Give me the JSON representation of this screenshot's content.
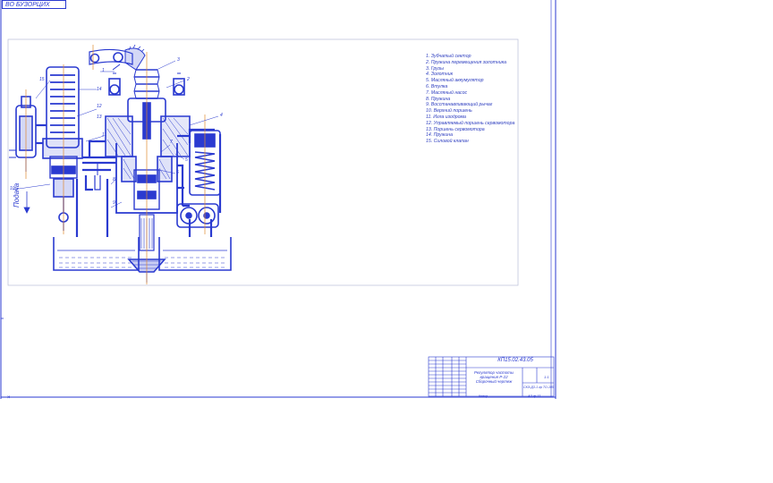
{
  "header": {
    "stamp": "ВО БУЗОРЦИХ"
  },
  "side_label": "Подача",
  "legend": [
    "1. Зубчатый сектор",
    "2. Пружина перемещения золотника",
    "3. Грузы",
    "4. Золотник",
    "5. Масляный аккумулятор",
    "6. Втулка",
    "7. Масляный насос",
    "8. Пружина",
    "9. Восстанавливающий рычаг",
    "10. Верхний поршень",
    "11. Игла изодрома",
    "12. Управляемый поршень сервомотора",
    "13. Поршень сервомотора",
    "14. Пружина",
    "15. Силовой клапан"
  ],
  "callouts": [
    "1",
    "2",
    "3",
    "4",
    "5",
    "6",
    "7",
    "8",
    "9",
    "10",
    "11",
    "12",
    "13",
    "14",
    "15"
  ],
  "title_block": {
    "code": "КП15.02.43.05",
    "title_lines": [
      "Регулятор частоты",
      "вращения Р-22",
      "Сборочный чертеж"
    ],
    "sheet": "1:1",
    "organization": "СКЭ-Д3-1 гр ТО-105",
    "format": "А3 ф.11",
    "format_left": "Копир"
  },
  "colors": {
    "line": "#2a3ad0",
    "accent": "#e08a30",
    "fill": "#2a3ad0"
  }
}
